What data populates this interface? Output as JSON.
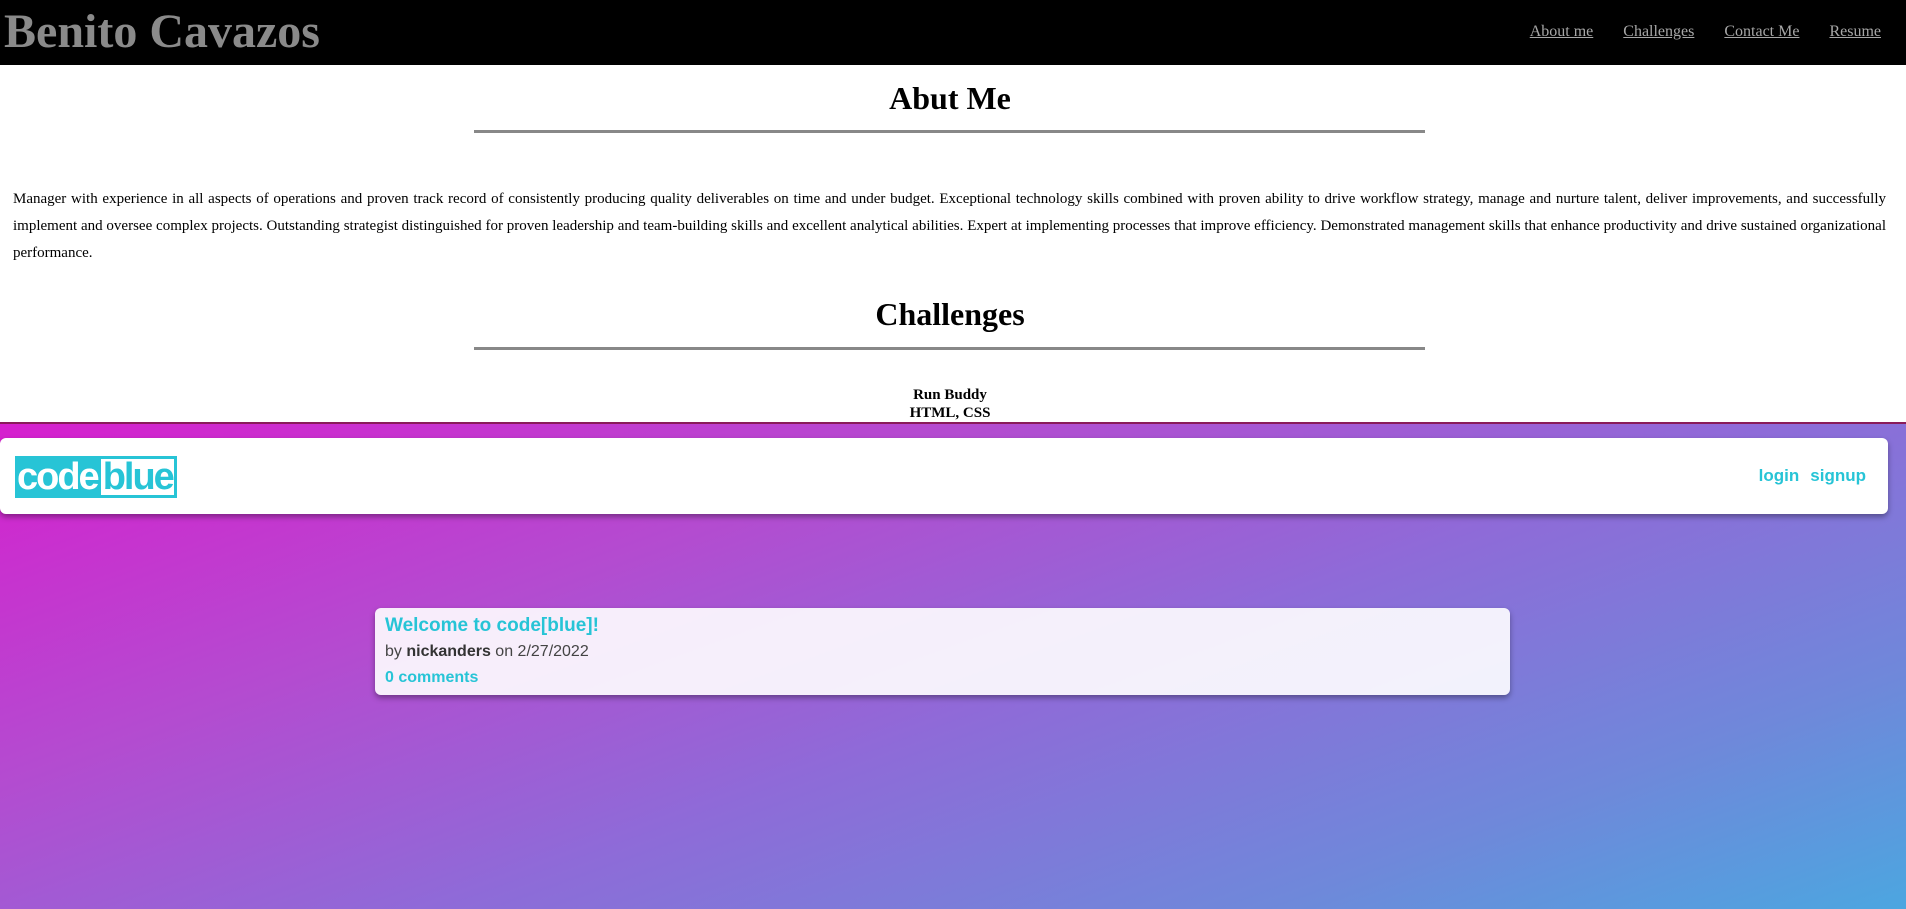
{
  "header": {
    "site_name": "Benito Cavazos",
    "nav": [
      {
        "label": "About me"
      },
      {
        "label": "Challenges"
      },
      {
        "label": "Contact Me"
      },
      {
        "label": "Resume"
      }
    ]
  },
  "about": {
    "heading": "Abut Me",
    "text": "Manager with experience in all aspects of operations and proven track record of consistently producing quality deliverables on time and under budget. Exceptional technology skills combined with proven ability to drive workflow strategy, manage and nurture talent, deliver improvements, and successfully implement and oversee complex projects. Outstanding strategist distinguished for proven leadership and team-building skills and excellent analytical abilities. Expert at implementing processes that improve efficiency. Demonstrated management skills that enhance productivity and drive sustained organizational performance."
  },
  "challenges": {
    "heading": "Challenges",
    "project": {
      "title": "Run Buddy",
      "tech": "HTML, CSS"
    }
  },
  "preview": {
    "logo": {
      "part1": "code",
      "part2": "blue"
    },
    "links": {
      "login": "login",
      "signup": "signup"
    },
    "post": {
      "title": "Welcome to code[blue]!",
      "by": "by",
      "author": "nickanders",
      "on": "on",
      "date": "2/27/2022",
      "comments": "0 comments"
    }
  },
  "colors": {
    "header_bg": "#000000",
    "site_name": "#8a8a8a",
    "accent": "#27c4d6",
    "gradient_start": "#d61fce",
    "gradient_end": "#4ca6e0"
  }
}
